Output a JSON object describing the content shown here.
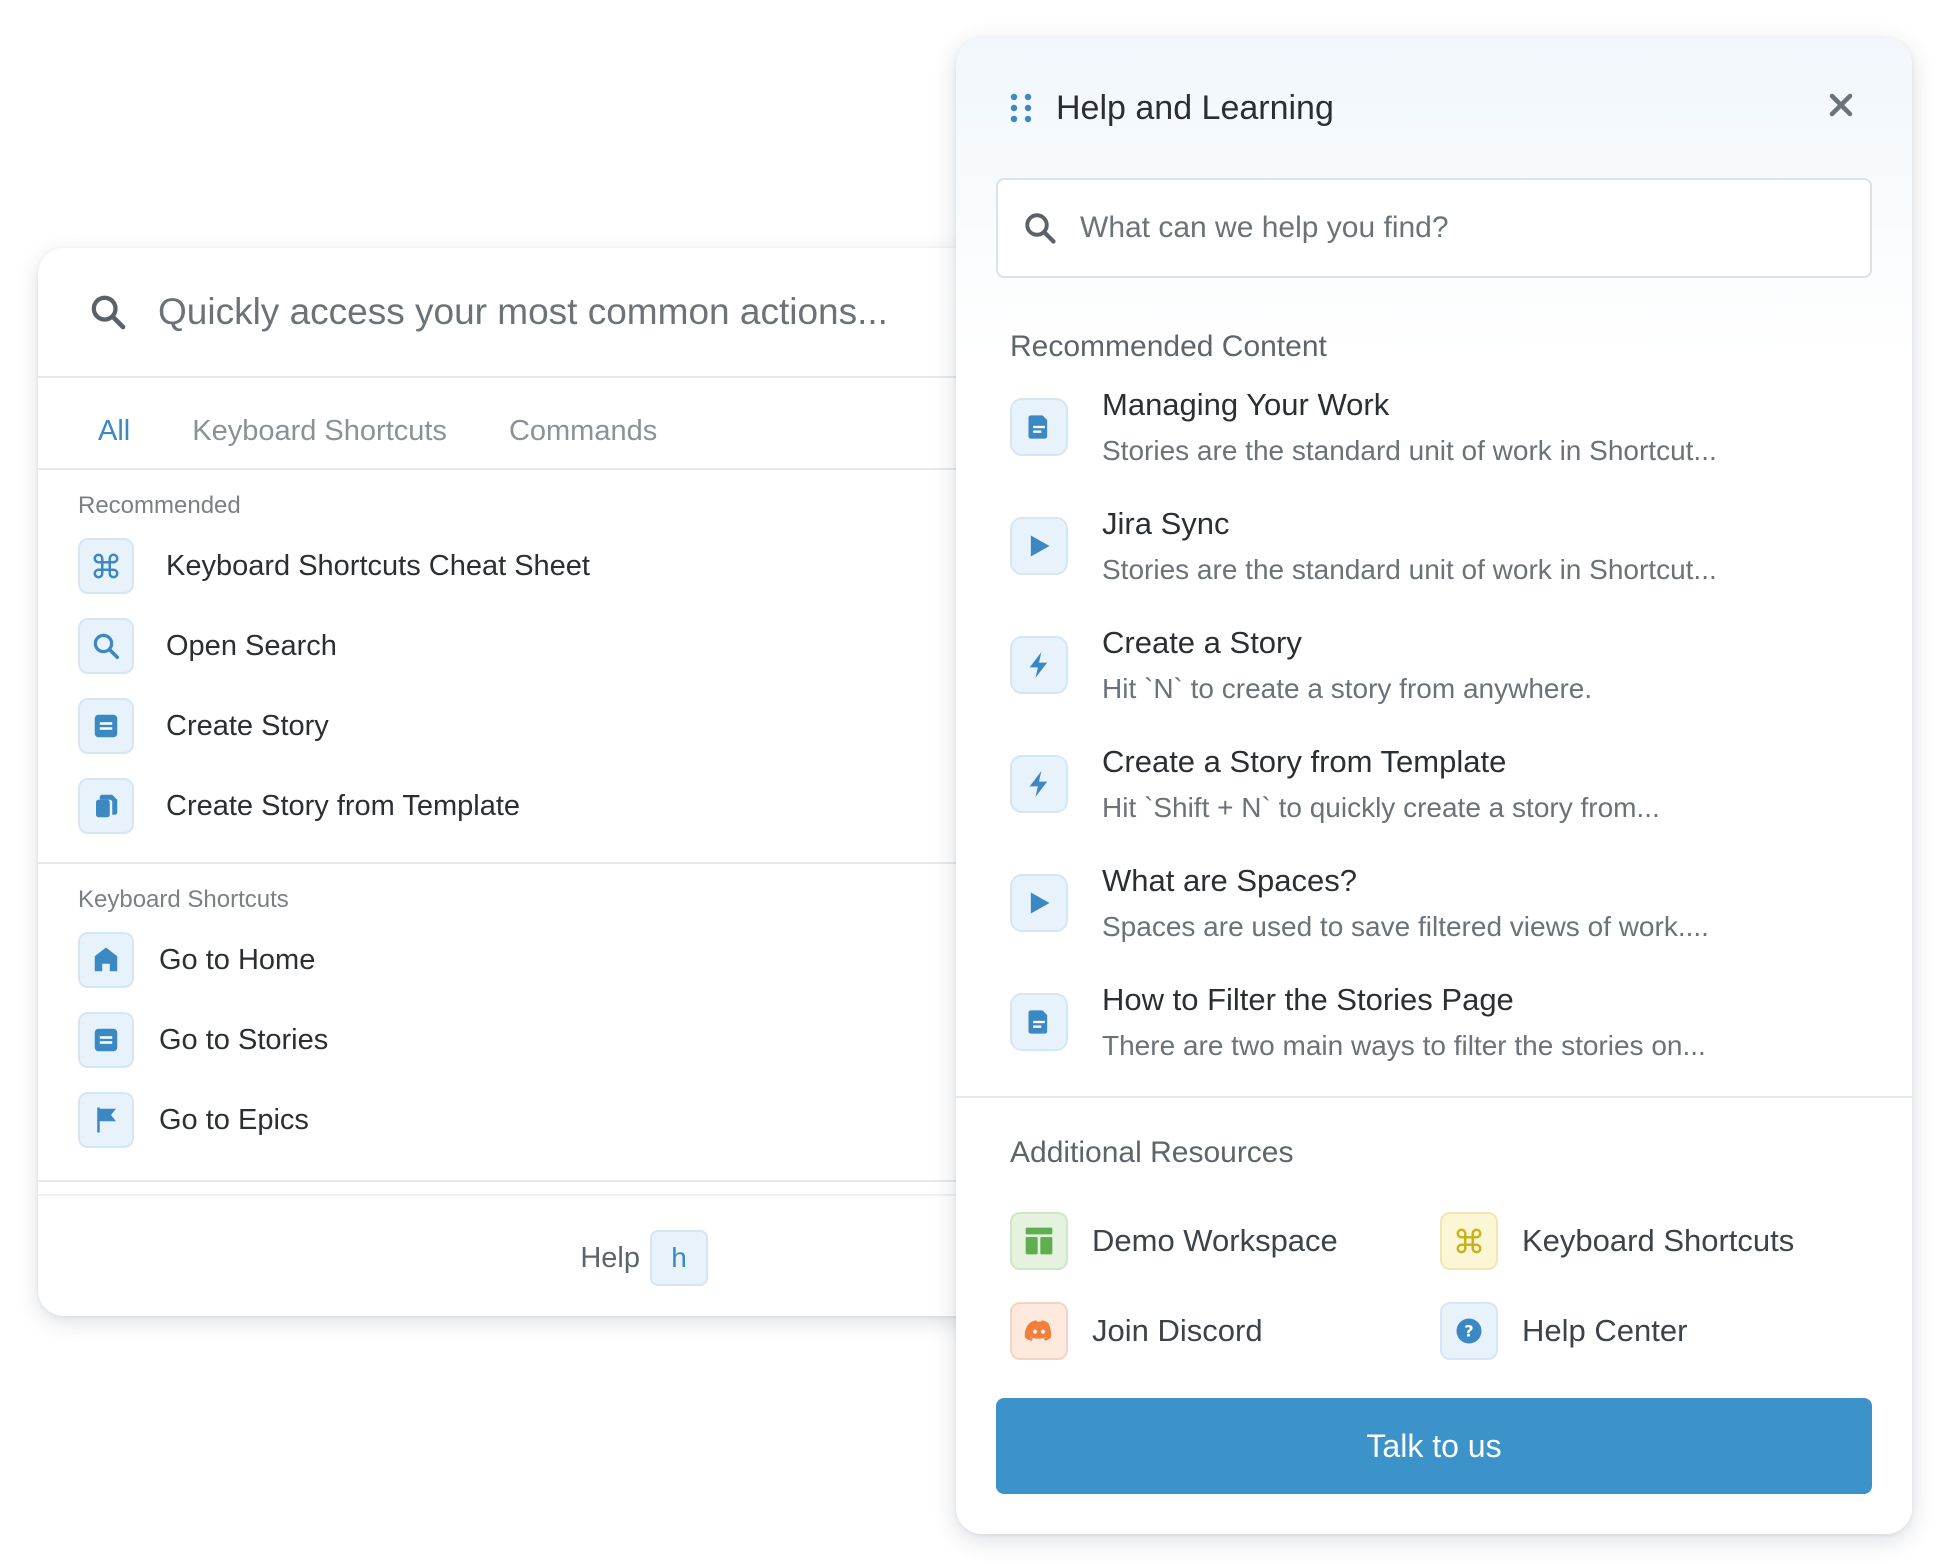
{
  "palette": {
    "search_placeholder": "Quickly access your most common actions...",
    "tabs": [
      {
        "label": "All",
        "active": true
      },
      {
        "label": "Keyboard Shortcuts",
        "active": false
      },
      {
        "label": "Commands",
        "active": false
      }
    ],
    "recommended": {
      "label": "Recommended",
      "items": [
        {
          "label": "Keyboard Shortcuts Cheat Sheet",
          "icon": "command-icon"
        },
        {
          "label": "Open Search",
          "icon": "search-icon"
        },
        {
          "label": "Create Story",
          "icon": "story-icon"
        },
        {
          "label": "Create Story from Template",
          "icon": "copy-icon"
        }
      ]
    },
    "shortcuts": {
      "label": "Keyboard Shortcuts",
      "items": [
        {
          "label": "Go to Home",
          "icon": "home-icon"
        },
        {
          "label": "Go to Stories",
          "icon": "story-icon"
        },
        {
          "label": "Go to Epics",
          "icon": "flag-icon"
        }
      ]
    },
    "help": {
      "label": "Help",
      "key": "h"
    }
  },
  "help_panel": {
    "title": "Help and Learning",
    "search_placeholder": "What can we help you find?",
    "recommended_label": "Recommended Content",
    "items": [
      {
        "title": "Managing Your Work",
        "desc": "Stories are the standard unit of work in Shortcut...",
        "icon": "doc-icon"
      },
      {
        "title": "Jira Sync",
        "desc": "Stories are the standard unit of work in Shortcut...",
        "icon": "play-icon"
      },
      {
        "title": "Create a Story",
        "desc": "Hit `N` to create a story from anywhere.",
        "icon": "bolt-icon"
      },
      {
        "title": "Create a Story from Template",
        "desc": "Hit `Shift + N` to quickly create a story from...",
        "icon": "bolt-icon"
      },
      {
        "title": "What are Spaces?",
        "desc": "Spaces are used to save filtered views of work....",
        "icon": "play-icon"
      },
      {
        "title": "How to Filter the Stories Page",
        "desc": "There are two main ways to filter the stories on...",
        "icon": "doc-icon"
      }
    ],
    "additional_label": "Additional Resources",
    "resources": [
      {
        "label": "Demo Workspace",
        "icon": "layout-icon",
        "color": "#5fae4f"
      },
      {
        "label": "Keyboard Shortcuts",
        "icon": "command-icon",
        "color": "#c9b21a"
      },
      {
        "label": "Join Discord",
        "icon": "discord-icon",
        "color": "#f07f3c"
      },
      {
        "label": "Help Center",
        "icon": "question-icon",
        "color": "#3b88c3"
      }
    ],
    "cta": "Talk to us"
  },
  "colors": {
    "accent": "#3b88c3",
    "button": "#3b93c9"
  }
}
